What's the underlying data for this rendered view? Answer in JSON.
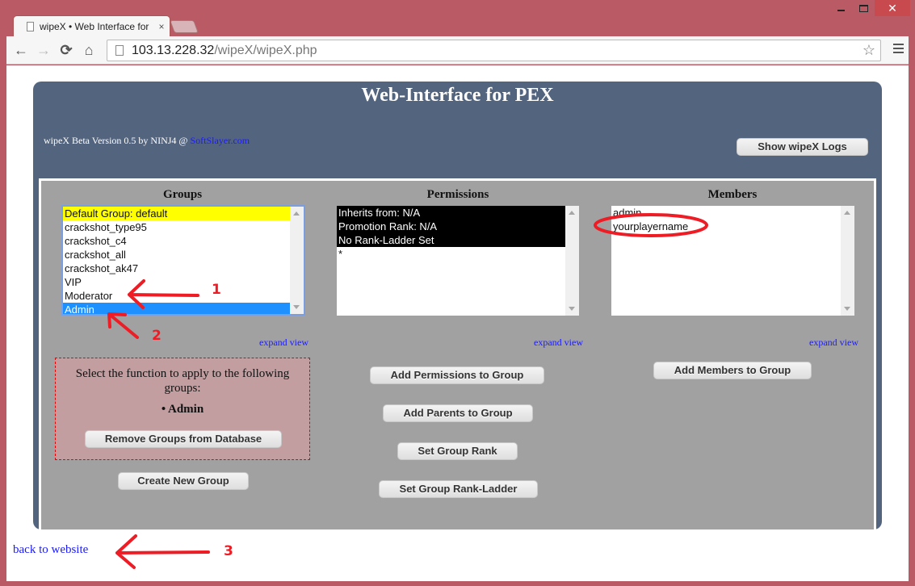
{
  "browser": {
    "tab_title": "wipeX • Web Interface for",
    "tab_close": "×",
    "url_host": "103.13.228.32",
    "url_path": "/wipeX/wipeX.php",
    "nav": {
      "back": "←",
      "forward": "→",
      "reload": "⟳",
      "home": "⌂"
    },
    "star": "☆",
    "window": {
      "close": "✕"
    }
  },
  "page": {
    "title": "Web-Interface for PEX",
    "version_text": "wipeX Beta Version 0.5 by NINJ4 @ ",
    "version_link": "SoftSlayer.com",
    "show_logs_button": "Show wipeX Logs",
    "groups": {
      "heading": "Groups",
      "items": [
        {
          "label": "Default Group: default",
          "state": "default"
        },
        {
          "label": "crackshot_type95",
          "state": "normal"
        },
        {
          "label": "crackshot_c4",
          "state": "normal"
        },
        {
          "label": "crackshot_all",
          "state": "normal"
        },
        {
          "label": "crackshot_ak47",
          "state": "normal"
        },
        {
          "label": "VIP",
          "state": "normal"
        },
        {
          "label": "Moderator",
          "state": "normal"
        },
        {
          "label": "Admin",
          "state": "selected"
        }
      ],
      "expand_link": "expand view"
    },
    "permissions": {
      "heading": "Permissions",
      "items": [
        {
          "label": "Inherits from: N/A",
          "state": "info"
        },
        {
          "label": "Promotion Rank: N/A",
          "state": "info"
        },
        {
          "label": "No Rank-Ladder Set",
          "state": "info"
        },
        {
          "label": "*",
          "state": "normal"
        }
      ],
      "expand_link": "expand view"
    },
    "members": {
      "heading": "Members",
      "items": [
        {
          "label": "admin"
        },
        {
          "label": "yourplayername"
        }
      ],
      "expand_link": "expand view"
    },
    "function_box": {
      "text": "Select the function to apply to the following groups:",
      "selected_group": "• Admin",
      "remove_button": "Remove Groups from Database"
    },
    "buttons": {
      "create_group": "Create New Group",
      "add_permissions": "Add Permissions to Group",
      "add_parents": "Add Parents to Group",
      "set_rank": "Set Group Rank",
      "set_rank_ladder": "Set Group Rank-Ladder",
      "add_members": "Add Members to Group"
    },
    "back_link": "back to website"
  },
  "annotations": {
    "color": "#ee1c24",
    "labels": [
      "1",
      "2",
      "3"
    ]
  }
}
